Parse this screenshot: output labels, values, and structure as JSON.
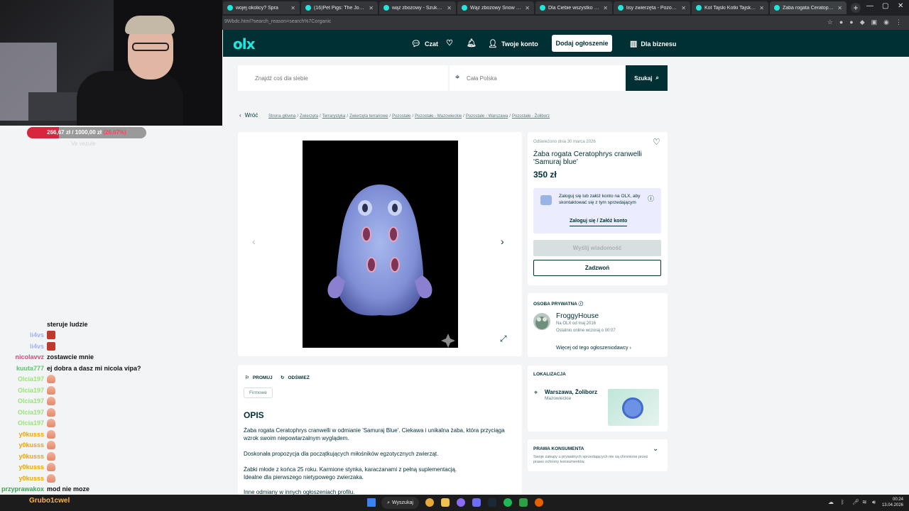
{
  "browser": {
    "tabs": [
      {
        "label": "wojej okolicy? Spra",
        "active": false
      },
      {
        "label": "(16)Pet Pigs: The Joy of Mini",
        "active": false
      },
      {
        "label": "wąż zbożowy - Szukaj w Goo",
        "active": false
      },
      {
        "label": "Wąż zbożowy Snow stripe 0",
        "active": false
      },
      {
        "label": "Dla Ciebie wszystko - sprzed",
        "active": false
      },
      {
        "label": "lisy zwierzęta - Pozostałe Zw",
        "active": false
      },
      {
        "label": "Kot Tajski Kotki Tajskie Koteł",
        "active": false
      },
      {
        "label": "Żaba rogata Ceratophrys cra",
        "active": true
      }
    ],
    "url": "9Wbdc.html?search_reason=search%7Corganic"
  },
  "olx": {
    "logo": "olx",
    "chat": "Czat",
    "account": "Twoje konto",
    "post_ad": "Dodaj ogłoszenie",
    "business": "Dla biznesu",
    "search_placeholder": "Znajdź coś dla siebie",
    "location_placeholder": "Cała Polska",
    "search_button": "Szukaj",
    "back": "Wróć",
    "breadcrumb": [
      "Strona główna",
      "Zwierzęta",
      "Terrarystyka",
      "Zwierzęta terrariowe",
      "Pozostałe",
      "Pozostałe - Mazowieckie",
      "Pozostałe - Warszawa",
      "Pozostałe - Żoliborz"
    ]
  },
  "offer": {
    "refreshed": "Odświeżono dnia 30 marca 2026",
    "title": "Żaba rogata Ceratophrys cranwelli 'Samuraj blue'",
    "price": "350 zł",
    "login_prompt": "Zaloguj się lub załóż konto na OLX, aby skontaktować się z tym sprzedającym",
    "login_link": "Zaloguj się / Załóż konto",
    "send_message": "Wyślij wiadomość",
    "call": "Zadzwoń"
  },
  "seller": {
    "section": "OSOBA PRYWATNA",
    "name": "FroggyHouse",
    "since": "Na OLX od maj 2016",
    "online": "Ostatnio online wczoraj o 00:07",
    "more": "Więcej od tego ogłoszeniodawcy"
  },
  "location": {
    "section": "LOKALIZACJA",
    "city": "Warszawa, Żoliborz",
    "region": "Mazowieckie"
  },
  "consumer": {
    "section": "PRAWA KONSUMENTA",
    "text": "Swoje zakupy u prywatnych sprzedających nie są chronione przez prawo ochrony konsumentów."
  },
  "description": {
    "promote": "PROMUJ",
    "refresh": "ODŚWIEŻ",
    "tag": "Firmowe",
    "title": "OPIS",
    "p1": "Żaba rogata Ceratophrys cranwelli w odmianie 'Samuraj Blue'. Ciekawa i unikalna żaba, która przyciąga wzrok swoim niepowtarzalnym wyglądem.",
    "p2": "Doskonała propozycja dla początkujących miłośników egzotycznych zwierząt.",
    "p3": "Żabki młode z końca 25 roku. Karmione stynka, karaczanami z pełną suplementacją.",
    "p4": "Idealne dla pierwszego nietypowego zwierzaka.",
    "p5": "Inne odmiany w innych ogłoszeniach profilu."
  },
  "stream": {
    "donation_amount": "266,67 zł",
    "donation_goal": "1000,00 zł",
    "donation_pct": "(26.67%)",
    "donation_fraction": 0.2667,
    "donation_label": "Ve vezule",
    "chat": [
      {
        "user": "",
        "msg": "steruje ludzie",
        "color": "#111111",
        "emote": ""
      },
      {
        "user": "li4vs",
        "msg": "",
        "color": "#9fb2ff",
        "emote": "fire"
      },
      {
        "user": "li4vs",
        "msg": "",
        "color": "#9fb2ff",
        "emote": "fire"
      },
      {
        "user": "nicolavvz",
        "msg": "zostawcie mnie",
        "color": "#e0457b",
        "emote": ""
      },
      {
        "user": "kuuta777",
        "msg": "ej dobra a dasz mi nicola vipa?",
        "color": "#58c86a",
        "emote": ""
      },
      {
        "user": "Olcia197",
        "msg": "",
        "color": "#9be37a",
        "emote": "thumb"
      },
      {
        "user": "Olcia197",
        "msg": "",
        "color": "#9be37a",
        "emote": "thumb"
      },
      {
        "user": "Olcia197",
        "msg": "",
        "color": "#9be37a",
        "emote": "thumb"
      },
      {
        "user": "Olcia197",
        "msg": "",
        "color": "#9be37a",
        "emote": "thumb"
      },
      {
        "user": "Olcia197",
        "msg": "",
        "color": "#9be37a",
        "emote": "thumb"
      },
      {
        "user": "y0kusss",
        "msg": "",
        "color": "#f0a500",
        "emote": "thumb"
      },
      {
        "user": "y0kusss",
        "msg": "",
        "color": "#f0a500",
        "emote": "thumb"
      },
      {
        "user": "y0kusss",
        "msg": "",
        "color": "#f0a500",
        "emote": "thumb"
      },
      {
        "user": "y0kusss",
        "msg": "",
        "color": "#f0a500",
        "emote": "thumb"
      },
      {
        "user": "y0kusss",
        "msg": "",
        "color": "#f0a500",
        "emote": "thumb"
      },
      {
        "user": "przyprawakox",
        "msg": "mod nie moze",
        "color": "#3aa655",
        "emote": ""
      }
    ],
    "bottom_user": "Grubo1cwel"
  },
  "taskbar": {
    "search": "Wyszukaj",
    "time": "00:24",
    "date": "13.04.2026"
  }
}
